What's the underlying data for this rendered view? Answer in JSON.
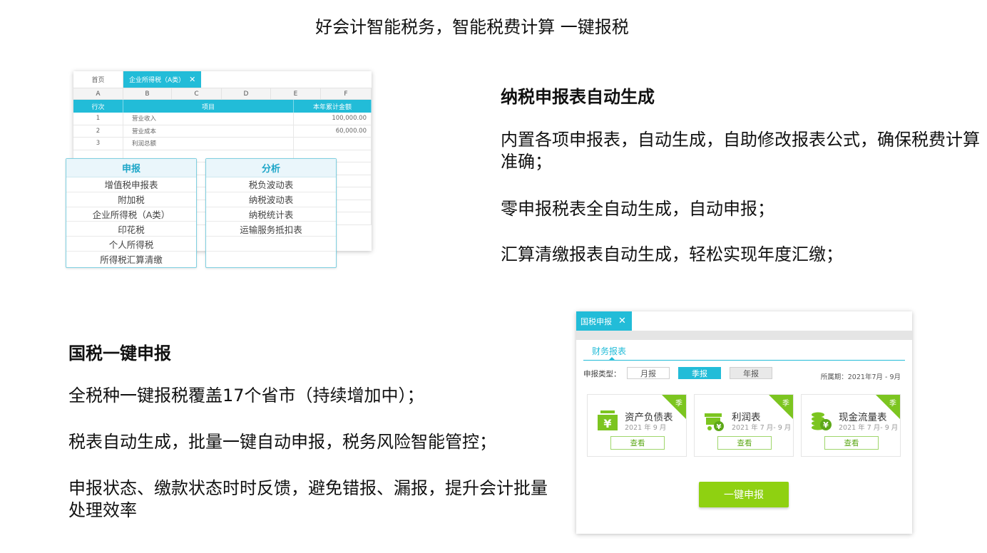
{
  "page_title": "好会计智能税务，智能税费计算 一键报税",
  "sheet": {
    "tab_home": "首页",
    "tab_active": "企业所得税（A类）",
    "tab_close": "✕",
    "col_letters": [
      "A",
      "B",
      "C",
      "D",
      "E",
      "F"
    ],
    "head": [
      "行次",
      "项目",
      "本年累计金额"
    ],
    "rows": [
      {
        "no": "1",
        "item": "营业收入",
        "amount": "100,000.00"
      },
      {
        "no": "2",
        "item": "营业成本",
        "amount": "60,000.00"
      },
      {
        "no": "3",
        "item": "利润总额",
        "amount": ""
      }
    ]
  },
  "menu_declare": {
    "title": "申报",
    "items": [
      "增值税申报表",
      "附加税",
      "企业所得税（A类）",
      "印花税",
      "个人所得税",
      "所得税汇算清缴"
    ]
  },
  "menu_analysis": {
    "title": "分析",
    "items": [
      "税负波动表",
      "纳税波动表",
      "纳税统计表",
      "运输服务抵扣表"
    ]
  },
  "section_auto": {
    "heading": "纳税申报表自动生成",
    "p1": "内置各项申报表，自动生成，自助修改报表公式，确保税费计算准确；",
    "p2": "零申报税表全自动生成，自动申报；",
    "p3": "汇算清缴报表自动生成，轻松实现年度汇缴；"
  },
  "section_declare": {
    "heading": "国税一键申报",
    "p1": "全税种一键报税覆盖17个省市（持续增加中）；",
    "p2": "税表自动生成，批量一键自动申报，税务风险智能管控；",
    "p3": "申报状态、缴款状态时时反馈，避免错报、漏报，提升会计批量处理效率"
  },
  "panel": {
    "tab": "国税申报",
    "tab_close": "✕",
    "sub_tab": "财务报表",
    "filter_label": "申报类型：",
    "periods": [
      "月报",
      "季报",
      "年报"
    ],
    "belong": "所属期：2021年7月 - 9月",
    "ribbon": "季",
    "cards": [
      {
        "name": "资产负债表",
        "period": "2021 年 9 月",
        "view": "查看",
        "icon": "money-icon"
      },
      {
        "name": "利润表",
        "period": "2021 年 7 月- 9 月",
        "view": "查看",
        "icon": "cart-icon"
      },
      {
        "name": "现金流量表",
        "period": "2021 年 7 月- 9 月",
        "view": "查看",
        "icon": "coins-icon"
      }
    ],
    "one_click": "一键申报"
  },
  "colors": {
    "accent_blue": "#22bcd8",
    "accent_green": "#7cc520"
  }
}
